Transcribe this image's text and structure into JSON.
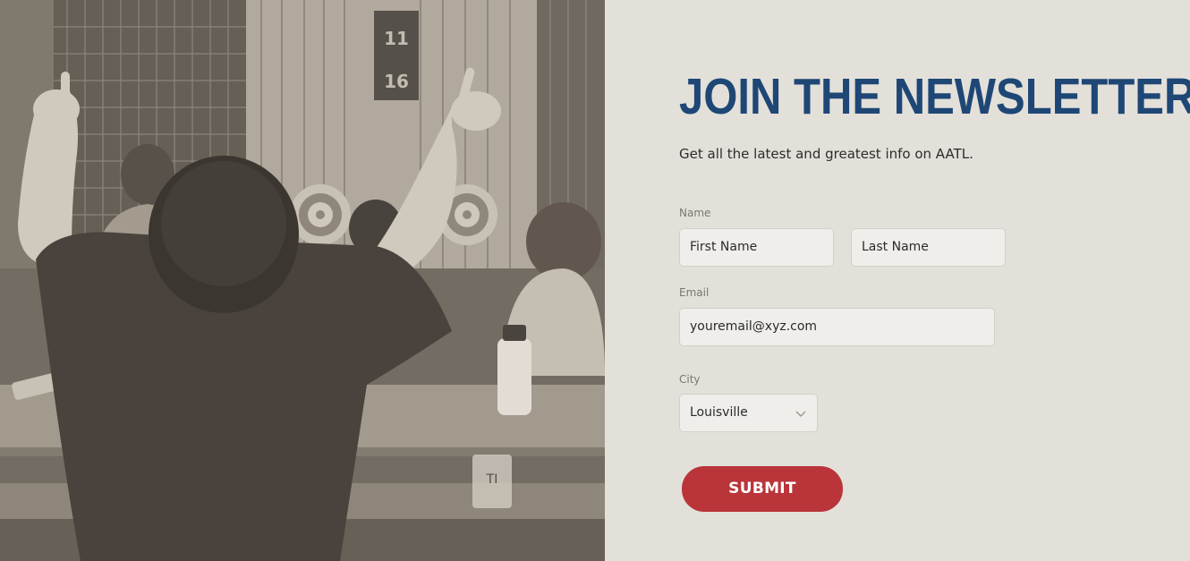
{
  "hero_image": {
    "alt": "people throwing axes at targets, one person raising arms",
    "sign_text": [
      "11",
      "16"
    ],
    "cup_text": "TI"
  },
  "newsletter": {
    "title": "JOIN THE NEWSLETTER",
    "subtitle": "Get all the latest and greatest info on AATL.",
    "name_label": "Name",
    "first_name_placeholder": "First Name",
    "last_name_placeholder": "Last Name",
    "email_label": "Email",
    "email_placeholder": "youremail@xyz.com",
    "city_label": "City",
    "city_selected": "Louisville",
    "submit_label": "SUBMIT"
  },
  "colors": {
    "title": "#1e4775",
    "submit": "#b9353a",
    "panel_bg": "#e3e0da",
    "input_bg": "#efeeeb"
  }
}
